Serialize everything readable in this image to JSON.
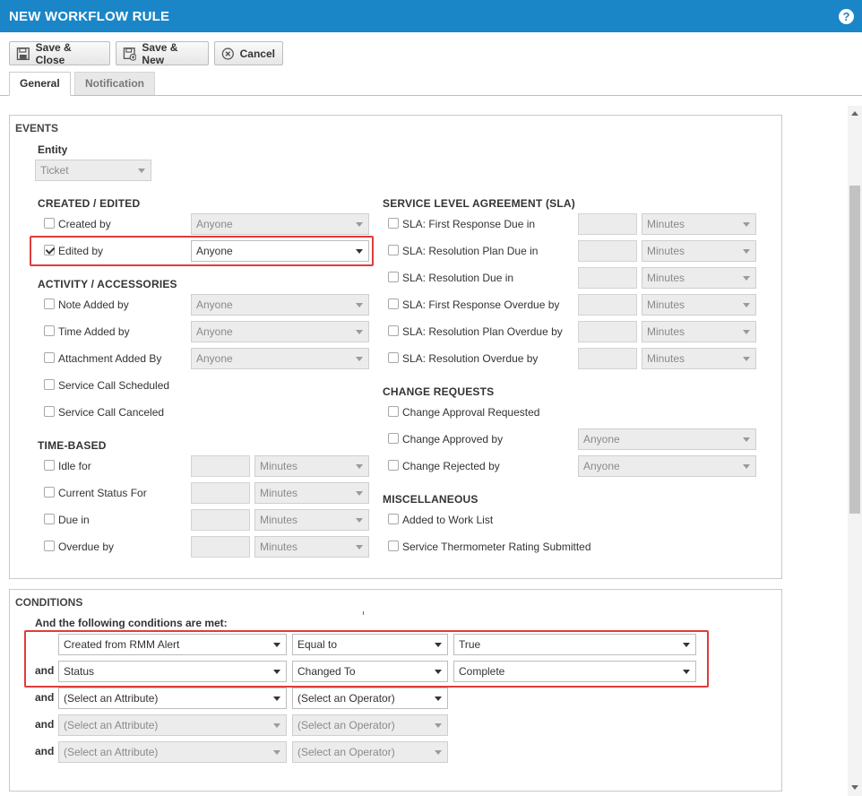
{
  "window": {
    "title": "NEW WORKFLOW RULE",
    "help_icon": "?"
  },
  "toolbar": {
    "save_close": {
      "label": "Save & Close",
      "icon": "floppy-disk-icon"
    },
    "save_new": {
      "label": "Save & New",
      "icon": "floppy-disk-plus-icon"
    },
    "cancel": {
      "label": "Cancel",
      "icon": "cancel-circle-icon"
    }
  },
  "tabs": [
    {
      "label": "General",
      "active": true
    },
    {
      "label": "Notification",
      "active": false
    }
  ],
  "events": {
    "title": "EVENTS",
    "entity": {
      "label": "Entity",
      "value": "Ticket"
    },
    "created_edited": {
      "title": "CREATED / EDITED",
      "rows": [
        {
          "label": "Created by",
          "checked": false,
          "value": "Anyone"
        },
        {
          "label": "Edited by",
          "checked": true,
          "value": "Anyone"
        }
      ]
    },
    "activity": {
      "title": "ACTIVITY / ACCESSORIES",
      "rows": [
        {
          "label": "Note Added by",
          "checked": false,
          "value": "Anyone"
        },
        {
          "label": "Time Added by",
          "checked": false,
          "value": "Anyone"
        },
        {
          "label": "Attachment Added By",
          "checked": false,
          "value": "Anyone"
        },
        {
          "label": "Service Call Scheduled",
          "checked": false
        },
        {
          "label": "Service Call Canceled",
          "checked": false
        }
      ]
    },
    "time_based": {
      "title": "TIME-BASED",
      "rows": [
        {
          "label": "Idle for",
          "checked": false,
          "amount": "",
          "unit": "Minutes"
        },
        {
          "label": "Current Status For",
          "checked": false,
          "amount": "",
          "unit": "Minutes"
        },
        {
          "label": "Due in",
          "checked": false,
          "amount": "",
          "unit": "Minutes"
        },
        {
          "label": "Overdue by",
          "checked": false,
          "amount": "",
          "unit": "Minutes"
        }
      ]
    },
    "sla": {
      "title": "SERVICE LEVEL AGREEMENT (SLA)",
      "rows": [
        {
          "label": "SLA: First Response Due in",
          "checked": false,
          "amount": "",
          "unit": "Minutes"
        },
        {
          "label": "SLA: Resolution Plan Due in",
          "checked": false,
          "amount": "",
          "unit": "Minutes"
        },
        {
          "label": "SLA: Resolution Due in",
          "checked": false,
          "amount": "",
          "unit": "Minutes"
        },
        {
          "label": "SLA: First Response Overdue by",
          "checked": false,
          "amount": "",
          "unit": "Minutes"
        },
        {
          "label": "SLA: Resolution Plan Overdue by",
          "checked": false,
          "amount": "",
          "unit": "Minutes"
        },
        {
          "label": "SLA: Resolution Overdue by",
          "checked": false,
          "amount": "",
          "unit": "Minutes"
        }
      ]
    },
    "change_requests": {
      "title": "CHANGE REQUESTS",
      "rows": [
        {
          "label": "Change Approval Requested",
          "checked": false
        },
        {
          "label": "Change Approved by",
          "checked": false,
          "value": "Anyone"
        },
        {
          "label": "Change Rejected by",
          "checked": false,
          "value": "Anyone"
        }
      ]
    },
    "misc": {
      "title": "MISCELLANEOUS",
      "rows": [
        {
          "label": "Added to Work List",
          "checked": false
        },
        {
          "label": "Service Thermometer Rating Submitted",
          "checked": false
        }
      ]
    }
  },
  "conditions": {
    "title": "CONDITIONS",
    "subtitle": "And the following conditions are met:",
    "rows": [
      {
        "prefix": "",
        "attribute": "Created from RMM Alert",
        "operator": "Equal to",
        "value": "True"
      },
      {
        "prefix": "and",
        "attribute": "Status",
        "operator": "Changed To",
        "value": "Complete"
      },
      {
        "prefix": "and",
        "attribute": "(Select an Attribute)",
        "operator": "(Select an Operator)"
      },
      {
        "prefix": "and",
        "attribute": "(Select an Attribute)",
        "operator": "(Select an Operator)"
      },
      {
        "prefix": "and",
        "attribute": "(Select an Attribute)",
        "operator": "(Select an Operator)"
      }
    ]
  },
  "colors": {
    "header_bg": "#1a86c8",
    "highlight": "#e03c3c"
  }
}
